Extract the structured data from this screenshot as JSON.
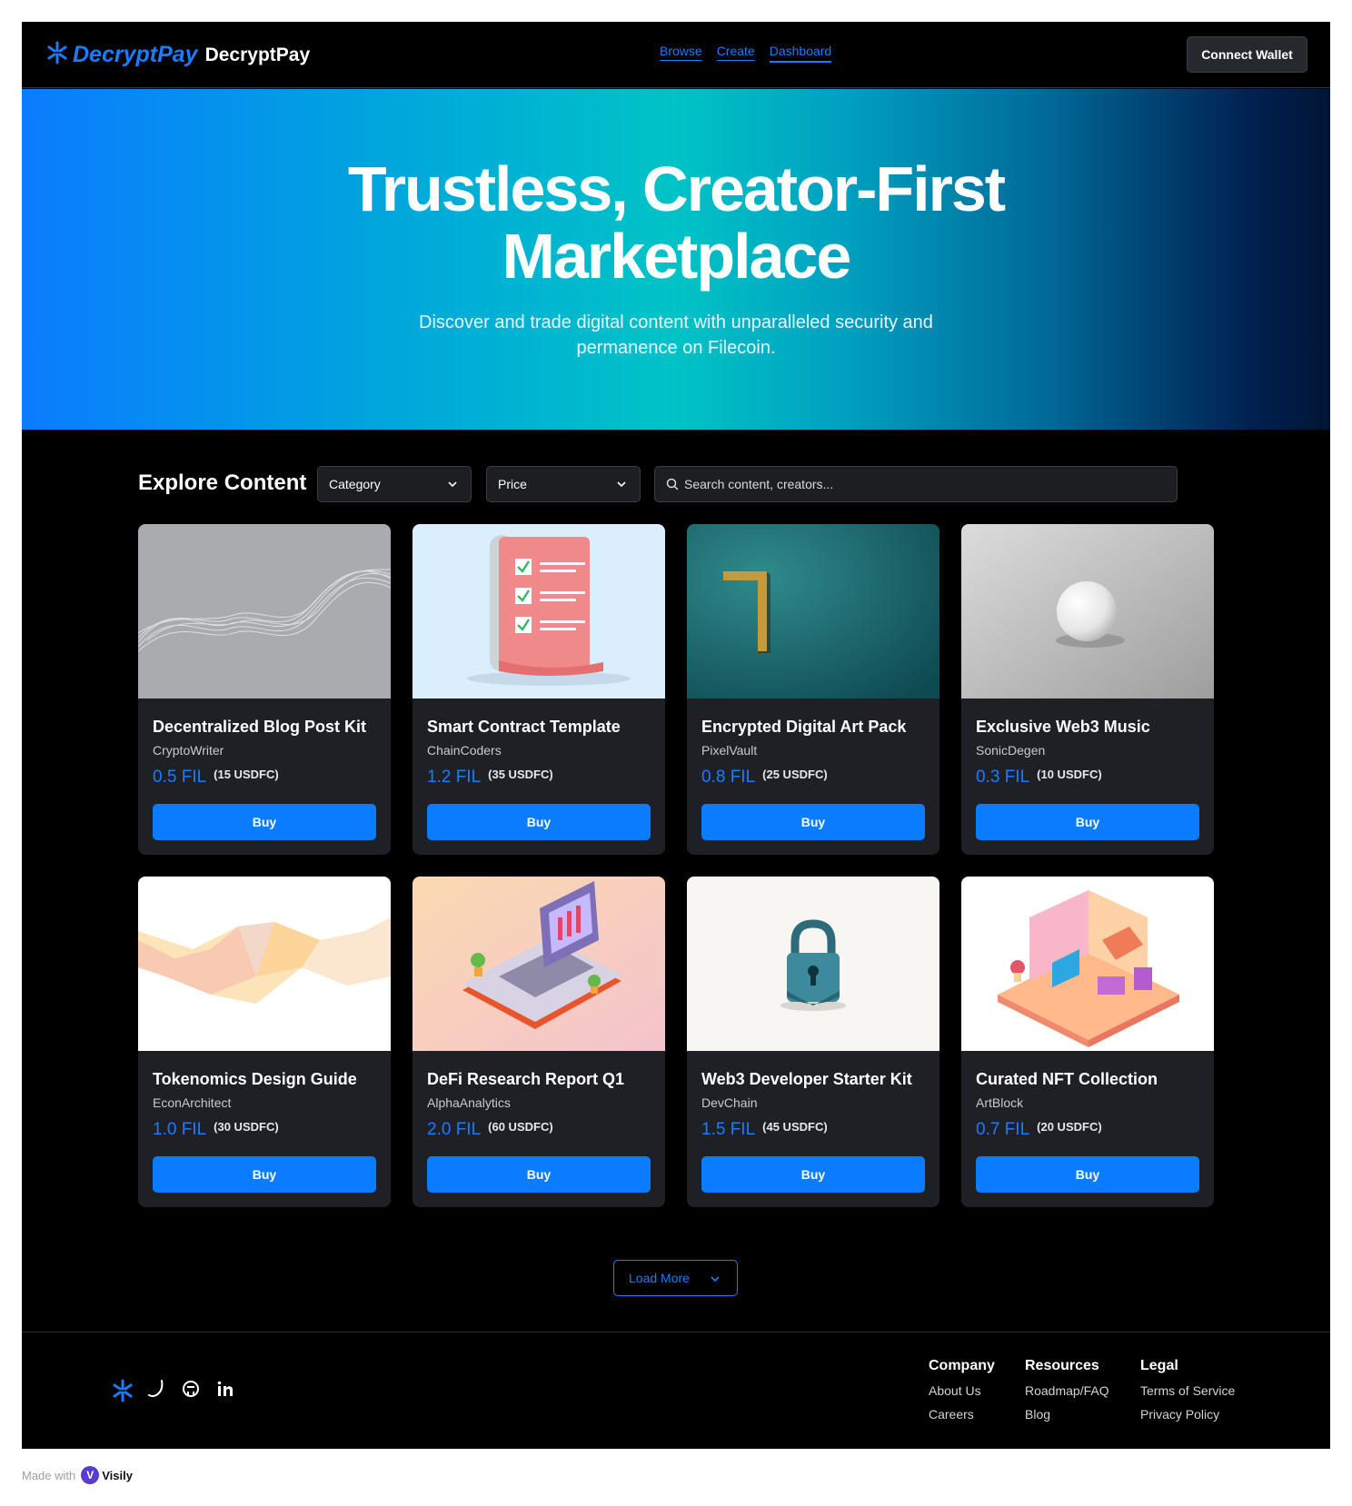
{
  "header": {
    "logo_text": "DecryptPay",
    "brand_name": "DecryptPay",
    "nav": [
      {
        "label": "Browse"
      },
      {
        "label": "Create"
      },
      {
        "label": "Dashboard"
      }
    ],
    "connect_label": "Connect Wallet"
  },
  "hero": {
    "title_line1": "Trustless, Creator-First",
    "title_line2": "Marketplace",
    "subtitle": "Discover and trade digital content with unparalleled security and permanence on Filecoin."
  },
  "explore": {
    "title": "Explore Content",
    "category_label": "Category",
    "price_label": "Price",
    "search_placeholder": "Search content, creators..."
  },
  "cards": [
    {
      "title": "Decentralized Blog Post Kit",
      "creator": "CryptoWriter",
      "fil": "0.5 FIL",
      "usd": "(15 USDFC)",
      "buy": "Buy",
      "image": "wave-lines"
    },
    {
      "title": "Smart Contract Template",
      "creator": "ChainCoders",
      "fil": "1.2 FIL",
      "usd": "(35 USDFC)",
      "buy": "Buy",
      "image": "checklist-scroll"
    },
    {
      "title": "Encrypted Digital Art Pack",
      "creator": "PixelVault",
      "fil": "0.8 FIL",
      "usd": "(25 USDFC)",
      "buy": "Buy",
      "image": "gold-bracket"
    },
    {
      "title": "Exclusive Web3 Music",
      "creator": "SonicDegen",
      "fil": "0.3 FIL",
      "usd": "(10 USDFC)",
      "buy": "Buy",
      "image": "white-sphere"
    },
    {
      "title": "Tokenomics Design Guide",
      "creator": "EconArchitect",
      "fil": "1.0 FIL",
      "usd": "(30 USDFC)",
      "buy": "Buy",
      "image": "low-poly"
    },
    {
      "title": "DeFi Research Report Q1",
      "creator": "AlphaAnalytics",
      "fil": "2.0 FIL",
      "usd": "(60 USDFC)",
      "buy": "Buy",
      "image": "isometric-laptop"
    },
    {
      "title": "Web3 Developer Starter Kit",
      "creator": "DevChain",
      "fil": "1.5 FIL",
      "usd": "(45 USDFC)",
      "buy": "Buy",
      "image": "padlock"
    },
    {
      "title": "Curated NFT Collection",
      "creator": "ArtBlock",
      "fil": "0.7 FIL",
      "usd": "(20 USDFC)",
      "buy": "Buy",
      "image": "isometric-room"
    }
  ],
  "load_more": "Load More",
  "footer": {
    "socials": [
      "decryptpay-icon",
      "twitter-icon",
      "github-icon",
      "linkedin-icon"
    ],
    "columns": [
      {
        "heading": "Company",
        "links": [
          "About Us",
          "Careers"
        ]
      },
      {
        "heading": "Resources",
        "links": [
          "Roadmap/FAQ",
          "Blog"
        ]
      },
      {
        "heading": "Legal",
        "links": [
          "Terms of Service",
          "Privacy Policy"
        ]
      }
    ]
  },
  "made_with": {
    "prefix": "Made with",
    "brand": "Visily"
  },
  "colors": {
    "accent": "#1a7cff",
    "button": "#0a7cff",
    "card_bg": "#1e2026",
    "page_bg": "#000000"
  }
}
